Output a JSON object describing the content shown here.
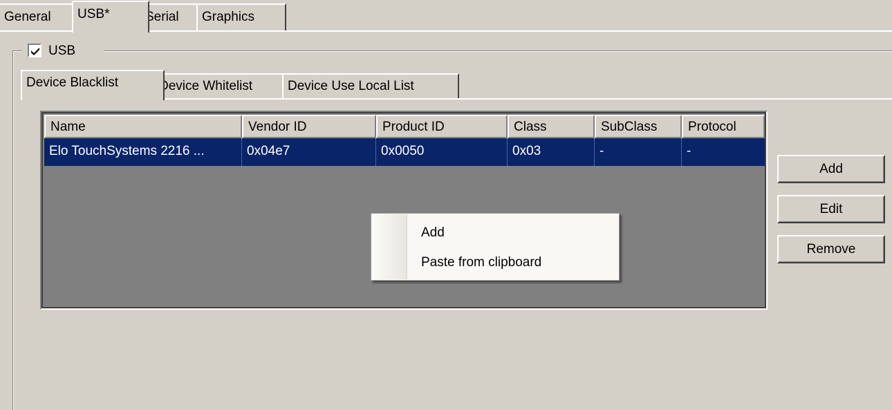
{
  "top_tabs": [
    {
      "label": "General"
    },
    {
      "label": "USB*"
    },
    {
      "label": "Serial"
    },
    {
      "label": "Graphics"
    }
  ],
  "usb_group": {
    "label": "USB",
    "checked": true
  },
  "sub_tabs": [
    {
      "label": "Device Blacklist"
    },
    {
      "label": "Device Whitelist"
    },
    {
      "label": "Device Use Local List"
    }
  ],
  "table": {
    "columns": [
      "Name",
      "Vendor ID",
      "Product ID",
      "Class",
      "SubClass",
      "Protocol"
    ],
    "rows": [
      [
        "Elo TouchSystems 2216 ...",
        "0x04e7",
        "0x0050",
        "0x03",
        "-",
        "-"
      ]
    ]
  },
  "buttons": {
    "add": "Add",
    "edit": "Edit",
    "remove": "Remove"
  },
  "context_menu": {
    "items": [
      "Add",
      "Paste from clipboard"
    ]
  },
  "colors": {
    "selection": "#0a246a",
    "face": "#d4d0c8",
    "list_bg": "#808080"
  }
}
